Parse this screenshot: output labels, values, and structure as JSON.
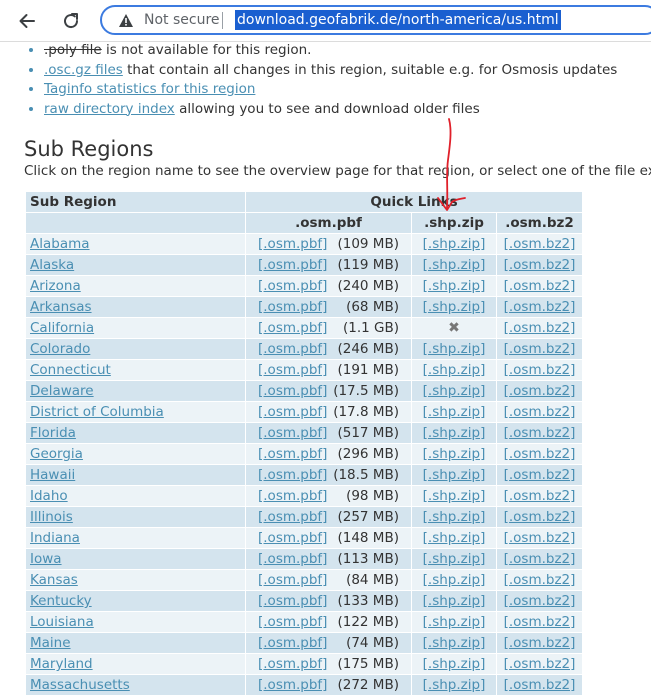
{
  "browser": {
    "security_label": "Not secure",
    "url": "download.geofabrik.de/north-america/us.html"
  },
  "features": [
    {
      "link": ".poly file",
      "rest": " is not available for this region.",
      "struck": true
    },
    {
      "link": ".osc.gz files",
      "rest": " that contain all changes in this region, suitable e.g. for Osmosis updates",
      "struck": false
    },
    {
      "link": "Taginfo statistics for this region",
      "rest": "",
      "struck": false
    },
    {
      "link": "raw directory index",
      "rest": " allowing you to see and download older files",
      "struck": false
    }
  ],
  "section": {
    "title": "Sub Regions",
    "description": "Click on the region name to see the overview page for that region, or select one of the file extens"
  },
  "table": {
    "header_region": "Sub Region",
    "header_quick_links": "Quick Links",
    "col_pbf": ".osm.pbf",
    "col_shp": ".shp.zip",
    "col_bz2": ".osm.bz2",
    "link_pbf": "[.osm.pbf]",
    "link_shp": "[.shp.zip]",
    "link_bz2": "[.osm.bz2]",
    "rows": [
      {
        "name": "Alabama",
        "size": "(109 MB)",
        "shp": true
      },
      {
        "name": "Alaska",
        "size": "(119 MB)",
        "shp": true
      },
      {
        "name": "Arizona",
        "size": "(240 MB)",
        "shp": true
      },
      {
        "name": "Arkansas",
        "size": "(68 MB)",
        "shp": true
      },
      {
        "name": "California",
        "size": "(1.1 GB)",
        "shp": false
      },
      {
        "name": "Colorado",
        "size": "(246 MB)",
        "shp": true
      },
      {
        "name": "Connecticut",
        "size": "(191 MB)",
        "shp": true
      },
      {
        "name": "Delaware",
        "size": "(17.5 MB)",
        "shp": true
      },
      {
        "name": "District of Columbia",
        "size": "(17.8 MB)",
        "shp": true
      },
      {
        "name": "Florida",
        "size": "(517 MB)",
        "shp": true
      },
      {
        "name": "Georgia",
        "size": "(296 MB)",
        "shp": true
      },
      {
        "name": "Hawaii",
        "size": "(18.5 MB)",
        "shp": true
      },
      {
        "name": "Idaho",
        "size": "(98 MB)",
        "shp": true
      },
      {
        "name": "Illinois",
        "size": "(257 MB)",
        "shp": true
      },
      {
        "name": "Indiana",
        "size": "(148 MB)",
        "shp": true
      },
      {
        "name": "Iowa",
        "size": "(113 MB)",
        "shp": true
      },
      {
        "name": "Kansas",
        "size": "(84 MB)",
        "shp": true
      },
      {
        "name": "Kentucky",
        "size": "(133 MB)",
        "shp": true
      },
      {
        "name": "Louisiana",
        "size": "(122 MB)",
        "shp": true
      },
      {
        "name": "Maine",
        "size": "(74 MB)",
        "shp": true
      },
      {
        "name": "Maryland",
        "size": "(175 MB)",
        "shp": true
      },
      {
        "name": "Massachusetts",
        "size": "(272 MB)",
        "shp": true
      }
    ]
  },
  "icons": {
    "back": "arrow-left-icon",
    "reload": "reload-icon",
    "warning": "warning-triangle-icon",
    "unavailable": "x-icon"
  },
  "colors": {
    "link": "#4a8fb3",
    "header_bg": "#d4e4ee",
    "row_alt_bg": "#ecf3f7",
    "url_highlight": "#1a5fd0",
    "annotation": "#e0202a"
  }
}
